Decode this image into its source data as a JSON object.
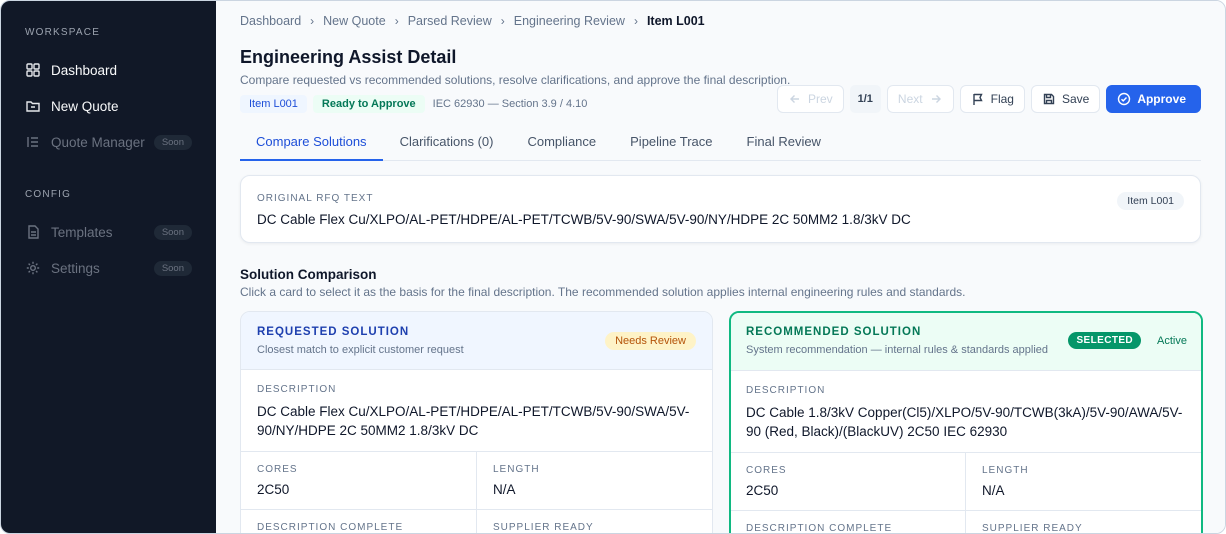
{
  "sidebar": {
    "workspace_label": "WORKSPACE",
    "config_label": "CONFIG",
    "items": [
      {
        "label": "Dashboard",
        "icon": "grid-icon"
      },
      {
        "label": "New Quote",
        "icon": "folder-icon"
      },
      {
        "label": "Quote Manager",
        "icon": "list-icon",
        "badge": "Soon"
      }
    ],
    "config_items": [
      {
        "label": "Templates",
        "icon": "document-icon",
        "badge": "Soon"
      },
      {
        "label": "Settings",
        "icon": "gear-icon",
        "badge": "Soon"
      }
    ]
  },
  "breadcrumb": [
    "Dashboard",
    "New Quote",
    "Parsed Review",
    "Engineering Review",
    "Item L001"
  ],
  "header": {
    "title": "Engineering Assist Detail",
    "subtitle": "Compare requested vs recommended solutions, resolve clarifications, and approve the final description.",
    "item_tag": "Item L001",
    "status_tag": "Ready to Approve",
    "standard": "IEC 62930 — Section 3.9 / 4.10"
  },
  "actions": {
    "prev": "Prev",
    "page": "1/1",
    "next": "Next",
    "flag": "Flag",
    "save": "Save",
    "approve": "Approve"
  },
  "tabs": [
    "Compare Solutions",
    "Clarifications (0)",
    "Compliance",
    "Pipeline Trace",
    "Final Review"
  ],
  "rfq": {
    "label": "ORIGINAL RFQ TEXT",
    "text": "DC Cable Flex Cu/XLPO/AL-PET/HDPE/AL-PET/TCWB/5V-90/SWA/5V-90/NY/HDPE 2C 50MM2 1.8/3kV DC",
    "item": "Item L001"
  },
  "solutions": {
    "title": "Solution Comparison",
    "subtitle": "Click a card to select it as the basis for the final description. The recommended solution applies internal engineering rules and standards.",
    "requested": {
      "title": "REQUESTED SOLUTION",
      "subtitle": "Closest match to explicit customer request",
      "badge": "Needs Review",
      "description_label": "DESCRIPTION",
      "description": "DC Cable Flex Cu/XLPO/AL-PET/HDPE/AL-PET/TCWB/5V-90/SWA/5V-90/NY/HDPE 2C 50MM2 1.8/3kV DC",
      "cores_label": "CORES",
      "cores": "2C50",
      "length_label": "LENGTH",
      "length": "N/A",
      "desc_complete_label": "DESCRIPTION COMPLETE",
      "supplier_ready_label": "SUPPLIER READY"
    },
    "recommended": {
      "title": "RECOMMENDED SOLUTION",
      "subtitle": "System recommendation — internal rules & standards applied",
      "badge_selected": "SELECTED",
      "badge_active": "Active",
      "description_label": "DESCRIPTION",
      "description": "DC Cable 1.8/3kV Copper(Cl5)/XLPO/5V-90/TCWB(3kA)/5V-90/AWA/5V-90 (Red, Black)/(BlackUV) 2C50 IEC 62930",
      "cores_label": "CORES",
      "cores": "2C50",
      "length_label": "LENGTH",
      "length": "N/A",
      "desc_complete_label": "DESCRIPTION COMPLETE",
      "supplier_ready_label": "SUPPLIER READY"
    }
  },
  "colors": {
    "sidebar_bg": "#111827",
    "primary": "#2563eb",
    "success": "#059669",
    "warning": "#b45309"
  }
}
